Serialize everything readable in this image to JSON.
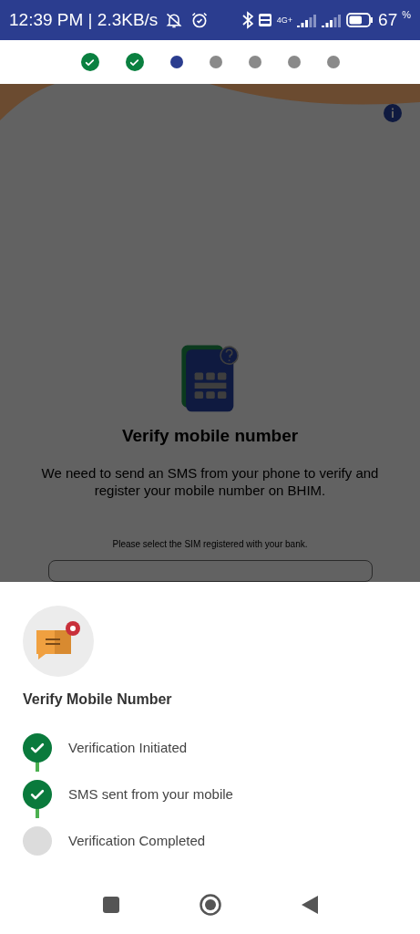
{
  "status_bar": {
    "time": "12:39 PM | 2.3KB/s",
    "network": "4G+",
    "battery": "67",
    "battery_unit": "%"
  },
  "progress_steps": [
    {
      "done": true,
      "selected": false
    },
    {
      "done": true,
      "selected": false
    },
    {
      "done": false,
      "selected": true
    },
    {
      "done": false,
      "selected": false
    },
    {
      "done": false,
      "selected": false
    },
    {
      "done": false,
      "selected": false
    },
    {
      "done": false,
      "selected": false
    }
  ],
  "page": {
    "title": "Verify mobile number",
    "description": "We need to send an SMS from your phone to verify and register your mobile number on BHIM.",
    "sim_prompt": "Please select the SIM registered with your bank."
  },
  "sheet": {
    "title": "Verify Mobile Number",
    "steps": [
      {
        "label": "Verification Initiated",
        "done": true
      },
      {
        "label": "SMS sent from your mobile",
        "done": true
      },
      {
        "label": "Verification Completed",
        "done": false
      }
    ]
  }
}
